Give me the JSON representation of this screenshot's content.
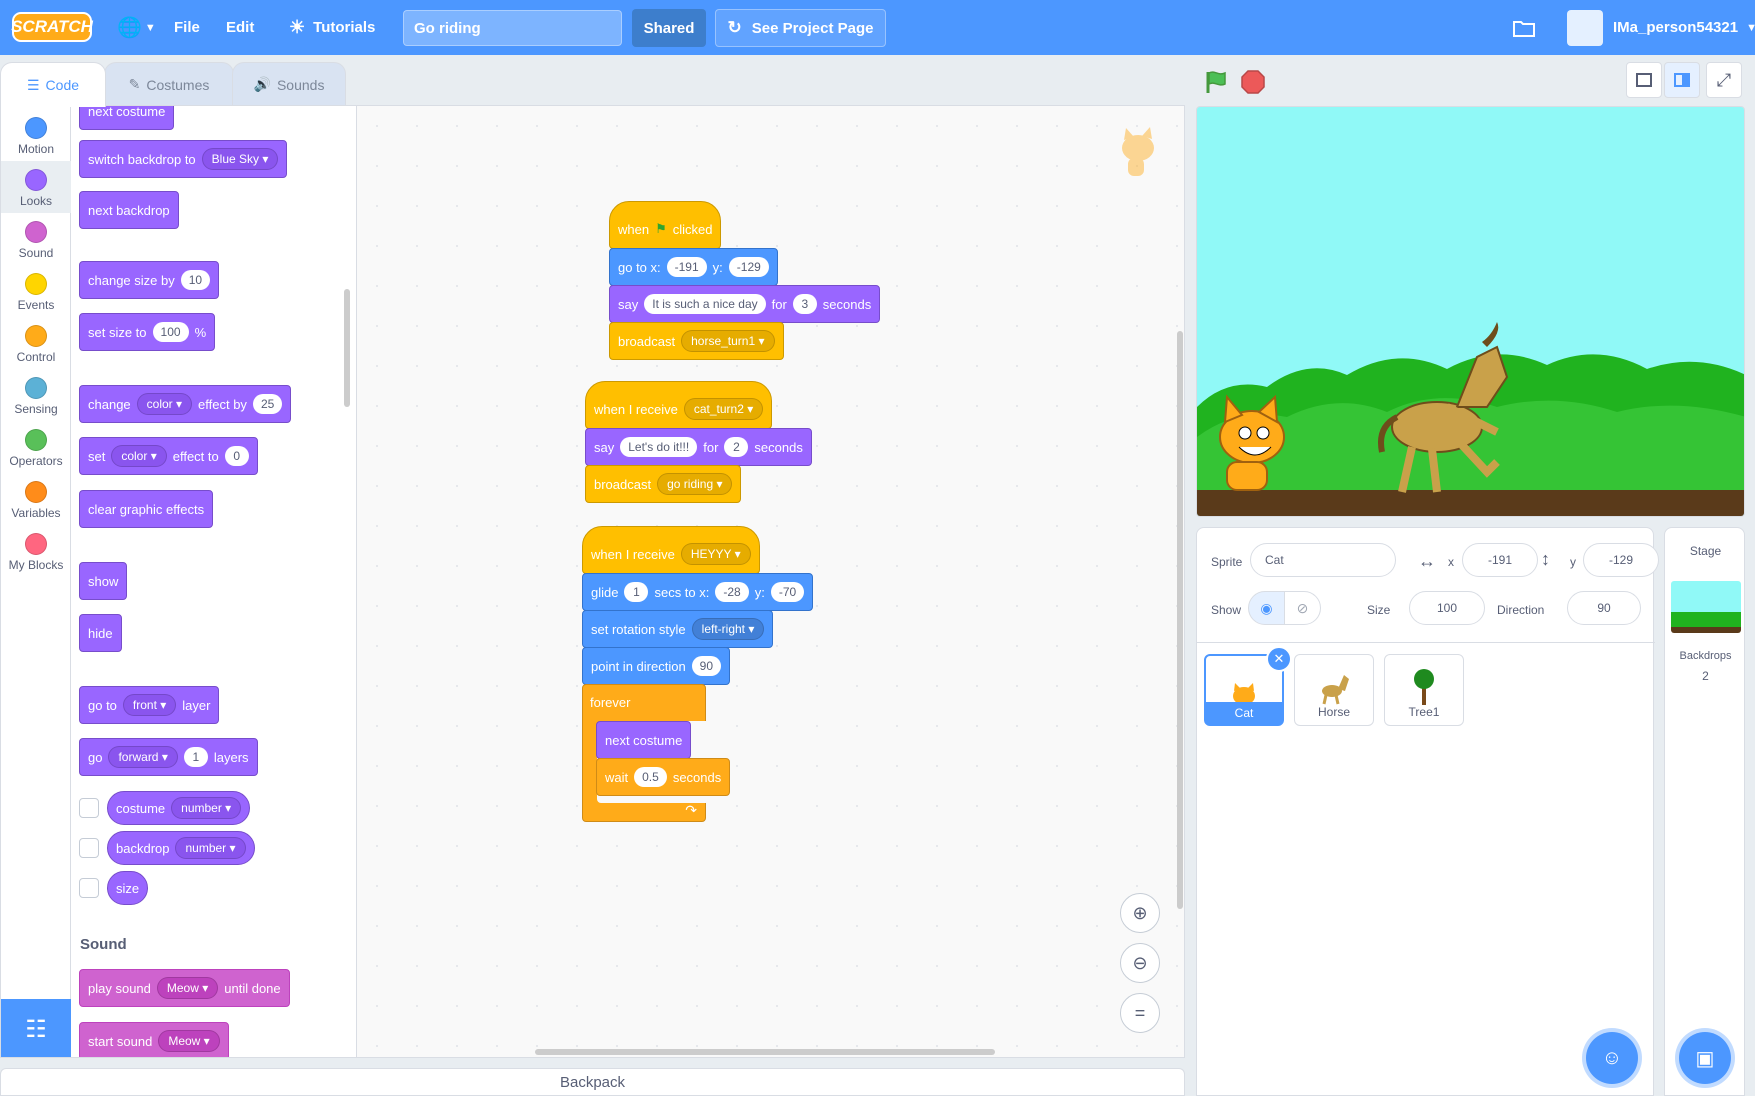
{
  "menubar": {
    "logo": "SCRATCH",
    "file": "File",
    "edit": "Edit",
    "tutorials": "Tutorials",
    "project_title": "Go riding",
    "shared": "Shared",
    "see_project_page": "See Project Page",
    "username": "IMa_person54321"
  },
  "tabs": {
    "code": "Code",
    "costumes": "Costumes",
    "sounds": "Sounds"
  },
  "categories": [
    {
      "label": "Motion",
      "color": "#4c97ff"
    },
    {
      "label": "Looks",
      "color": "#9966ff"
    },
    {
      "label": "Sound",
      "color": "#cf63cf"
    },
    {
      "label": "Events",
      "color": "#ffd500"
    },
    {
      "label": "Control",
      "color": "#ffab19"
    },
    {
      "label": "Sensing",
      "color": "#5cb1d6"
    },
    {
      "label": "Operators",
      "color": "#59c059"
    },
    {
      "label": "Variables",
      "color": "#ff8c1a"
    },
    {
      "label": "My Blocks",
      "color": "#ff6680"
    }
  ],
  "palette": {
    "next_costume": "next costume",
    "switch_backdrop": "switch backdrop to",
    "backdrop_value": "Blue Sky",
    "next_backdrop": "next backdrop",
    "change_size": "change size by",
    "change_size_val": "10",
    "set_size": "set size to",
    "set_size_val": "100",
    "pct": "%",
    "change_effect": "change",
    "effect_color": "color",
    "effect_by": "effect by",
    "effect_by_val": "25",
    "set_effect": "set",
    "effect_to": "effect to",
    "effect_to_val": "0",
    "clear_effects": "clear graphic effects",
    "show": "show",
    "hide": "hide",
    "go_to": "go to",
    "front": "front",
    "layer": "layer",
    "go": "go",
    "forward": "forward",
    "layers_val": "1",
    "layers": "layers",
    "costume": "costume",
    "number": "number",
    "backdrop": "backdrop",
    "size": "size",
    "sound_section": "Sound",
    "play_sound": "play sound",
    "meow": "Meow",
    "until_done": "until done",
    "start_sound": "start sound"
  },
  "scripts": {
    "s1": {
      "when": "when",
      "clicked": "clicked",
      "goto": "go to x:",
      "x": "-191",
      "y_lbl": "y:",
      "y": "-129",
      "say": "say",
      "say_text": "It is such a nice day",
      "for": "for",
      "secs": "3",
      "seconds": "seconds",
      "broadcast": "broadcast",
      "msg": "horse_turn1"
    },
    "s2": {
      "when_receive": "when I receive",
      "msg": "cat_turn2",
      "say": "say",
      "say_text": "Let's do it!!!",
      "for": "for",
      "secs": "2",
      "seconds": "seconds",
      "broadcast": "broadcast",
      "bmsg": "go riding"
    },
    "s3": {
      "when_receive": "when I receive",
      "msg": "HEYYY",
      "glide": "glide",
      "glide_secs": "1",
      "secs_to_x": "secs to x:",
      "x": "-28",
      "y_lbl": "y:",
      "y": "-70",
      "rot": "set rotation style",
      "rot_val": "left-right",
      "point": "point in direction",
      "dir": "90",
      "forever": "forever",
      "next_costume": "next costume",
      "wait": "wait",
      "wait_val": "0.5",
      "seconds": "seconds"
    }
  },
  "sprite_info": {
    "sprite_lbl": "Sprite",
    "name": "Cat",
    "x_lbl": "x",
    "x": "-191",
    "y_lbl": "y",
    "y": "-129",
    "show_lbl": "Show",
    "size_lbl": "Size",
    "size": "100",
    "dir_lbl": "Direction",
    "dir": "90"
  },
  "sprites": [
    {
      "name": "Cat"
    },
    {
      "name": "Horse"
    },
    {
      "name": "Tree1"
    }
  ],
  "stage_pane": {
    "title": "Stage",
    "backdrops_lbl": "Backdrops",
    "backdrops_count": "2"
  },
  "backpack": "Backpack"
}
